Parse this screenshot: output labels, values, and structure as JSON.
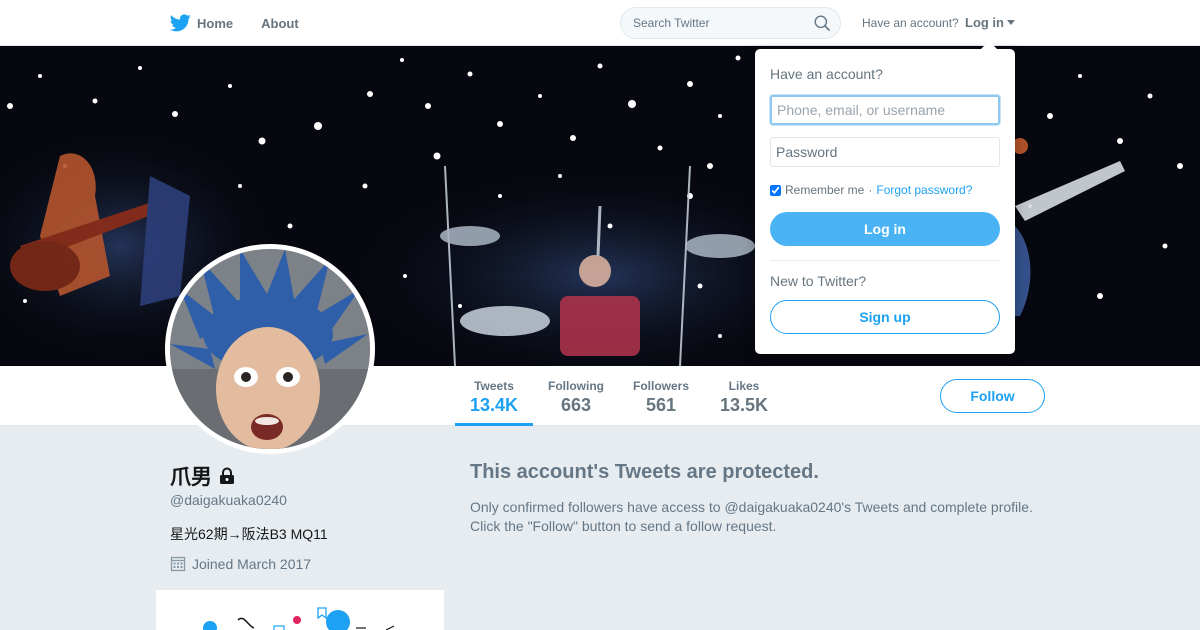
{
  "nav": {
    "home_label": "Home",
    "about_label": "About",
    "search_placeholder": "Search Twitter",
    "have_account": "Have an account?",
    "login_label": "Log in"
  },
  "profile": {
    "name": "爪男",
    "handle": "@daigakuaka0240",
    "bio": "星光62期→阪法B3 MQ11",
    "joined": "Joined March 2017"
  },
  "stats": [
    {
      "label": "Tweets",
      "value": "13.4K",
      "active": true
    },
    {
      "label": "Following",
      "value": "663",
      "active": false
    },
    {
      "label": "Followers",
      "value": "561",
      "active": false
    },
    {
      "label": "Likes",
      "value": "13.5K",
      "active": false
    }
  ],
  "follow_label": "Follow",
  "protected": {
    "title": "This account's Tweets are protected.",
    "line1": "Only confirmed followers have access to @daigakuaka0240's Tweets and complete profile.",
    "line2": "Click the \"Follow\" button to send a follow request."
  },
  "login_dropdown": {
    "heading": "Have an account?",
    "username_placeholder": "Phone, email, or username",
    "password_placeholder": "Password",
    "remember_label": "Remember me",
    "separator": "·",
    "forgot_label": "Forgot password?",
    "login_button": "Log in",
    "new_label": "New to Twitter?",
    "signup_button": "Sign up"
  },
  "colors": {
    "accent": "#1da1f2",
    "button_fill": "#4ab3f4",
    "page_bg": "#e6ecf0"
  }
}
